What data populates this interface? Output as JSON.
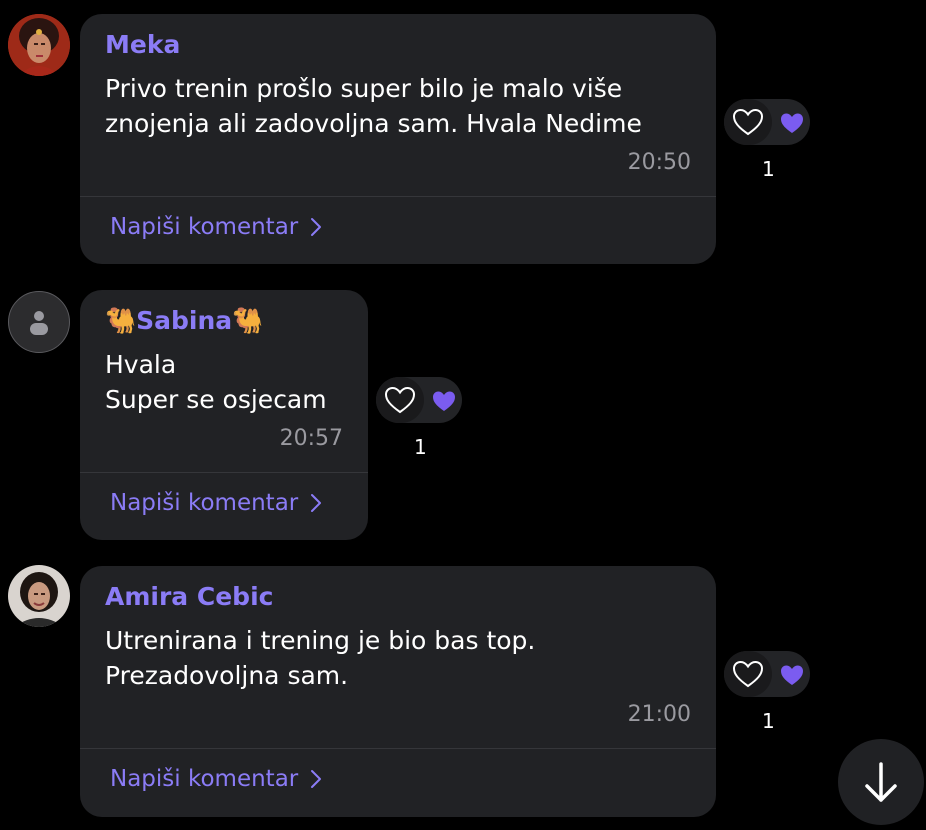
{
  "messages": [
    {
      "sender": "Meka",
      "lines": [
        "Privo trenin prošlo super bilo je malo više",
        "znojenja ali zadovoljna sam. Hvala Nedime"
      ],
      "time": "20:50",
      "comment_label": "Napiši komentar",
      "reaction_count": "1",
      "avatar": "photo-avatar"
    },
    {
      "sender_prefix": "🐫",
      "sender": "Sabina",
      "sender_suffix": "🐫",
      "lines": [
        "Hvala",
        "Super se osjecam"
      ],
      "time": "20:57",
      "comment_label": "Napiši komentar",
      "reaction_count": "1",
      "avatar": "default-user-avatar"
    },
    {
      "sender": "Amira Cebic",
      "lines": [
        "Utrenirana i trening je bio bas top.",
        "Prezadovoljna sam."
      ],
      "time": "21:00",
      "comment_label": "Napiši komentar",
      "reaction_count": "1",
      "avatar": "photo-avatar"
    }
  ],
  "colors": {
    "background": "#000000",
    "bubble": "#212225",
    "accent": "#8b7cf6",
    "time": "#9a9aa0"
  },
  "icons": {
    "reaction_outline": "heart-outline-icon",
    "reaction_filled": "purple-heart-icon",
    "comment_chevron": "chevron-right-icon",
    "scroll": "arrow-down-icon"
  }
}
